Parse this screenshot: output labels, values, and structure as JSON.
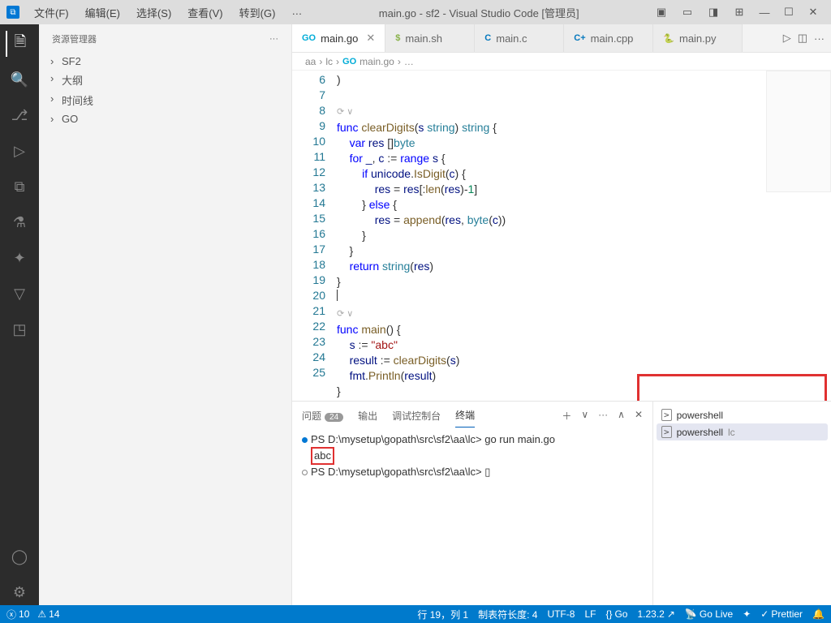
{
  "titlebar": {
    "menus": [
      "文件(F)",
      "编辑(E)",
      "选择(S)",
      "查看(V)",
      "转到(G)",
      "…"
    ],
    "title": "main.go - sf2 - Visual Studio Code [管理员]"
  },
  "sidebar": {
    "header": "资源管理器",
    "items": [
      "SF2",
      "大纲",
      "时间线",
      "GO"
    ]
  },
  "tabs": [
    {
      "icon": "GO",
      "label": "main.go",
      "cls": "go-icon",
      "active": true,
      "close": true
    },
    {
      "icon": "$",
      "label": "main.sh",
      "cls": "sh-icon"
    },
    {
      "icon": "C",
      "label": "main.c",
      "cls": "c-icon"
    },
    {
      "icon": "C+",
      "label": "main.cpp",
      "cls": "cpp-icon"
    },
    {
      "icon": "🐍",
      "label": "main.py",
      "cls": "py-icon"
    }
  ],
  "breadcrumb": [
    "aa",
    "lc",
    "main.go",
    "…"
  ],
  "code": {
    "lines": [
      {
        "n": "6",
        "html": ")"
      },
      {
        "n": "7",
        "html": ""
      },
      {
        "n": "",
        "html": "<span class='collapse-hint'>⟳ ∨</span>"
      },
      {
        "n": "8",
        "html": "<span class='kw'>func</span> <span class='fn'>clearDigits</span>(<span class='id'>s</span> <span class='ty'>string</span>) <span class='ty'>string</span> {"
      },
      {
        "n": "9",
        "html": "    <span class='kw'>var</span> <span class='id'>res</span> []<span class='ty'>byte</span>"
      },
      {
        "n": "10",
        "html": "    <span class='kw'>for</span> <span class='id'>_</span>, <span class='id'>c</span> := <span class='kw'>range</span> <span class='id'>s</span> {"
      },
      {
        "n": "11",
        "html": "        <span class='kw'>if</span> <span class='id'>unicode</span>.<span class='fn'>IsDigit</span>(<span class='id'>c</span>) {"
      },
      {
        "n": "12",
        "html": "            <span class='id'>res</span> = <span class='id'>res</span>[:<span class='fn'>len</span>(<span class='id'>res</span>)-<span class='num'>1</span>]"
      },
      {
        "n": "13",
        "html": "        } <span class='kw'>else</span> {"
      },
      {
        "n": "14",
        "html": "            <span class='id'>res</span> = <span class='fn'>append</span>(<span class='id'>res</span>, <span class='ty'>byte</span>(<span class='id'>c</span>))"
      },
      {
        "n": "15",
        "html": "        }"
      },
      {
        "n": "16",
        "html": "    }"
      },
      {
        "n": "17",
        "html": "    <span class='kw'>return</span> <span class='ty'>string</span>(<span class='id'>res</span>)"
      },
      {
        "n": "18",
        "html": "}"
      },
      {
        "n": "19",
        "html": "<span style='border-left:1px solid #333;height:14px;display:inline-block'></span>"
      },
      {
        "n": "",
        "html": "<span class='collapse-hint'>⟳ ∨</span>"
      },
      {
        "n": "20",
        "html": "<span class='kw'>func</span> <span class='fn'>main</span>() {"
      },
      {
        "n": "21",
        "html": "    <span class='id'>s</span> := <span class='str'>\"abc\"</span>"
      },
      {
        "n": "22",
        "html": "    <span class='id'>result</span> := <span class='fn'>clearDigits</span>(<span class='id'>s</span>)"
      },
      {
        "n": "23",
        "html": "    <span class='id'>fmt</span>.<span class='fn'>Println</span>(<span class='id'>result</span>)"
      },
      {
        "n": "24",
        "html": "}"
      },
      {
        "n": "25",
        "html": ""
      }
    ]
  },
  "panel": {
    "tabs": {
      "problems": "问题",
      "problems_badge": "24",
      "output": "输出",
      "debug": "调试控制台",
      "terminal": "终端"
    },
    "terminal_lines": [
      {
        "dot": "blue",
        "text": "PS D:\\mysetup\\gopath\\src\\sf2\\aa\\lc> go run main.go"
      },
      {
        "dot": "",
        "text": "<span class='redbox'>abc</span>"
      },
      {
        "dot": "open",
        "text": "PS D:\\mysetup\\gopath\\src\\sf2\\aa\\lc> ▯"
      }
    ],
    "side": [
      {
        "label": "powershell",
        "sel": false
      },
      {
        "label": "powershell",
        "sub": "lc",
        "sel": true
      }
    ]
  },
  "statusbar": {
    "errors": "10",
    "warnings": "14",
    "pos": "行 19，列 1",
    "tab": "制表符长度: 4",
    "enc": "UTF-8",
    "eol": "LF",
    "lang": "Go",
    "ver": "1.23.2",
    "golive": "Go Live",
    "prettier": "Prettier"
  }
}
